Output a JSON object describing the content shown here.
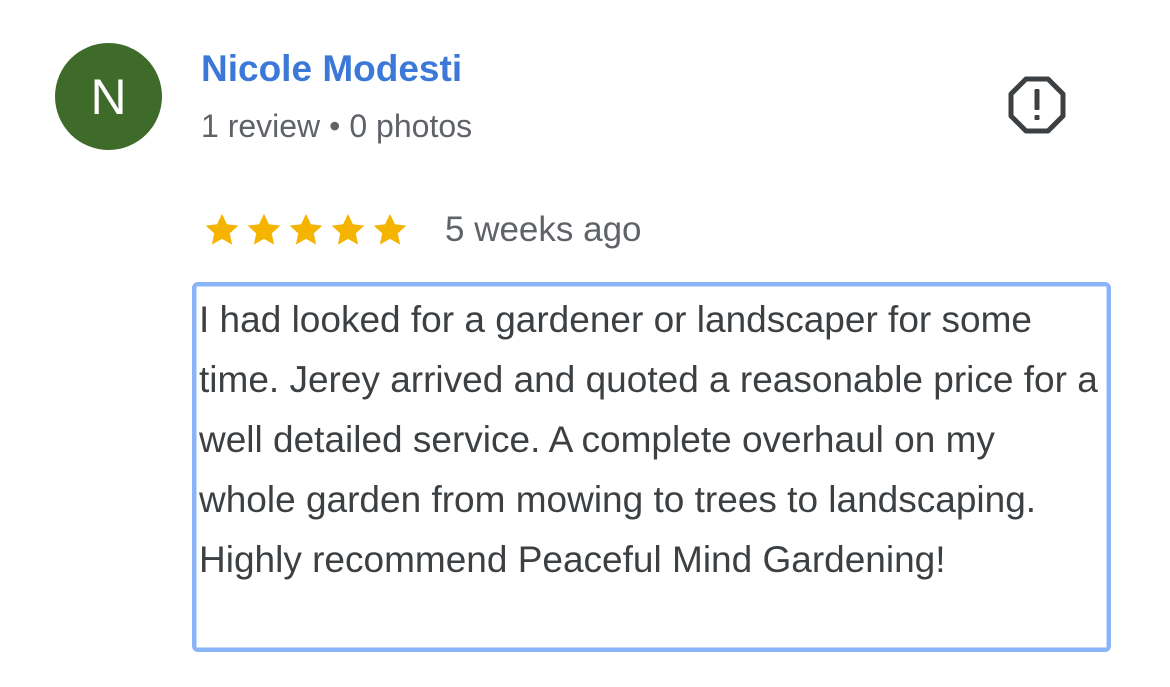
{
  "reviewer": {
    "initial": "N",
    "name": "Nicole Modesti",
    "reviews_count": "1 review",
    "separator": "•",
    "photos_count": "0 photos"
  },
  "review": {
    "rating": 5,
    "max_rating": 5,
    "date": "5 weeks ago",
    "text": "I had looked for a gardener or landscaper for some time. Jerey arrived and quoted a reasonable price for a well detailed service. A complete overhaul on my whole garden from mowing to trees to landscaping. Highly recommend Peaceful Mind Gardening!"
  },
  "icons": {
    "report": "report-flag-icon",
    "star": "star-icon"
  },
  "colors": {
    "avatar_bg": "#3f6b2a",
    "name": "#3b78d8",
    "star": "#f4b400",
    "icon": "#3c4043",
    "highlight_border": "#8ab4f8"
  }
}
